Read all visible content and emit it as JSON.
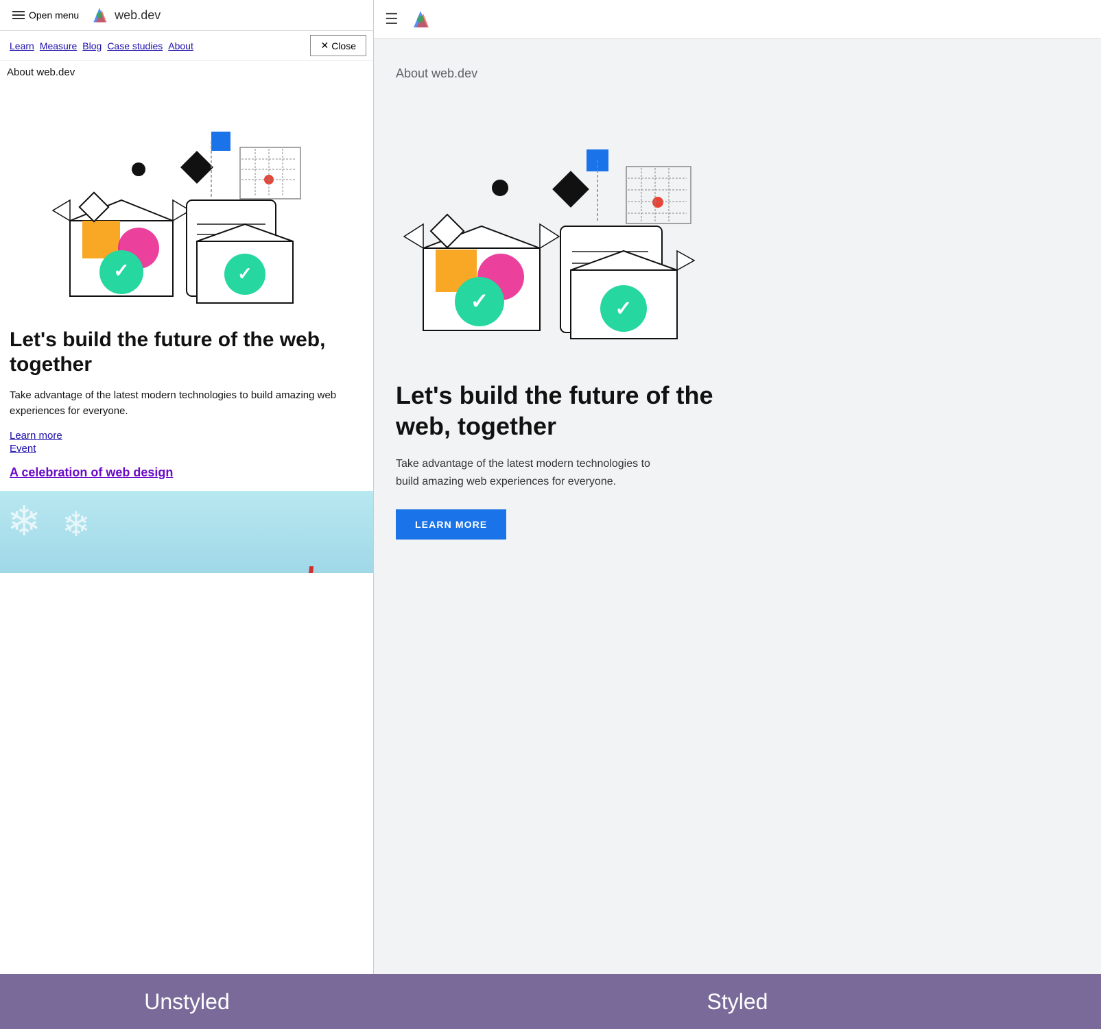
{
  "left": {
    "menu_label": "Open menu",
    "site_title": "web.dev",
    "nav_links": [
      "Learn",
      "Measure",
      "Blog",
      "Case studies",
      "About"
    ],
    "close_label": "Close",
    "about_label": "About web.dev",
    "hero_title": "Let's build the future of the web, together",
    "hero_desc": "Take advantage of the latest modern technologies to build amazing web experiences for everyone.",
    "link_learn": "Learn more",
    "link_event": "Event",
    "celebration_link": "A celebration of web design"
  },
  "right": {
    "about_label": "About web.dev",
    "hero_title": "Let's build the future of the web, together",
    "hero_desc": "Take advantage of the latest modern technologies to build amazing web experiences for everyone.",
    "btn_learn": "LEARN MORE"
  },
  "labels": {
    "unstyled": "Unstyled",
    "styled": "Styled"
  },
  "icons": {
    "hamburger": "☰",
    "close": "✕",
    "snowflake": "❄"
  }
}
